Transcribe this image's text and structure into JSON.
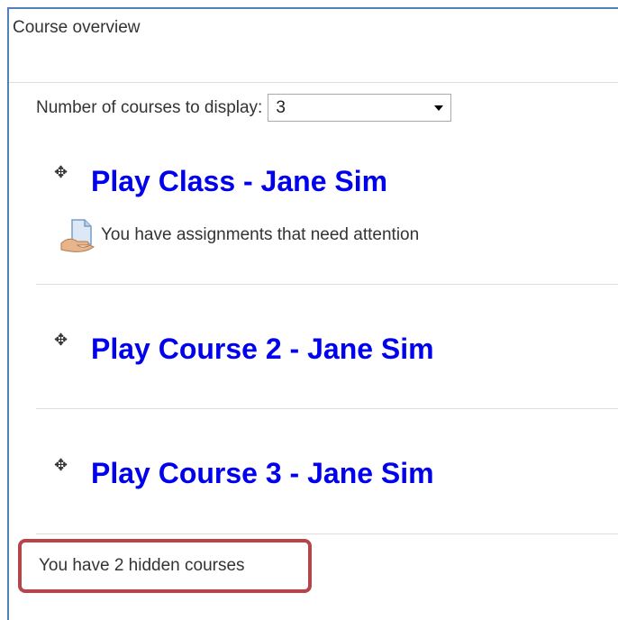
{
  "block": {
    "title": "Course overview",
    "accent_color": "#4f81bd"
  },
  "display": {
    "label": "Number of courses to display:",
    "selected_value": "3"
  },
  "courses": [
    {
      "title": "Play Class - Jane Sim",
      "notice": "You have assignments that need attention",
      "notice_icon": "assignment-hand-icon"
    },
    {
      "title": "Play Course 2 - Jane Sim"
    },
    {
      "title": "Play Course 3 - Jane Sim"
    }
  ],
  "move_icon": "move-icon",
  "move_glyph": "✥",
  "footer": {
    "hidden_courses_text": "You have 2 hidden courses",
    "highlight_color": "#b4464b"
  },
  "link_color": "#0000ee"
}
